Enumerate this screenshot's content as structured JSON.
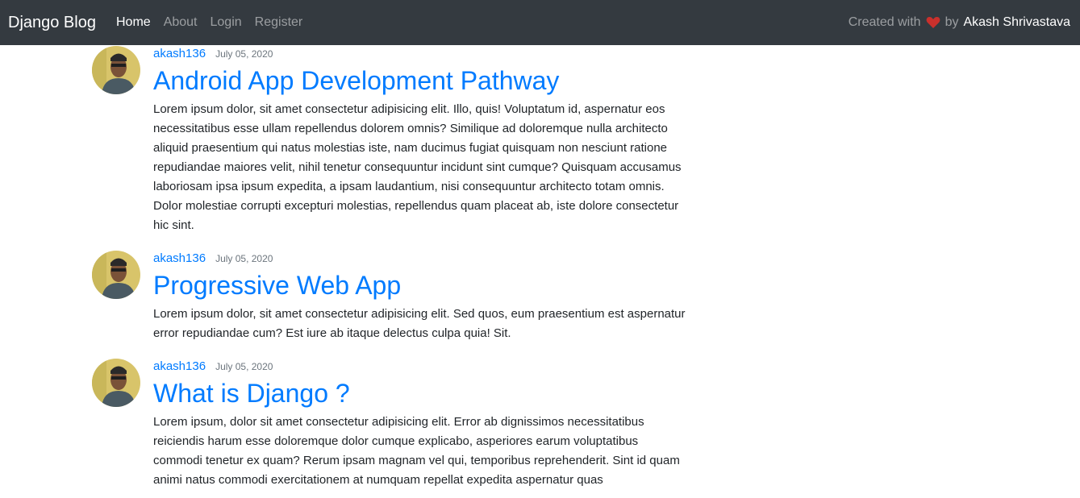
{
  "navbar": {
    "brand": "Django Blog",
    "links": [
      "Home",
      "About",
      "Login",
      "Register"
    ],
    "credit_prefix": "Created with",
    "credit_by": "by",
    "credit_author": "Akash Shrivastava",
    "heart_color": "#c9302c"
  },
  "posts": [
    {
      "author": "akash136",
      "date": "July 05, 2020",
      "title": "Android App Development Pathway",
      "content": "Lorem ipsum dolor, sit amet consectetur adipisicing elit. Illo, quis! Voluptatum id, aspernatur eos necessitatibus esse ullam repellendus dolorem omnis? Similique ad doloremque nulla architecto aliquid praesentium qui natus molestias iste, nam ducimus fugiat quisquam non nesciunt ratione repudiandae maiores velit, nihil tenetur consequuntur incidunt sint cumque? Quisquam accusamus laboriosam ipsa ipsum expedita, a ipsam laudantium, nisi consequuntur architecto totam omnis. Dolor molestiae corrupti excepturi molestias, repellendus quam placeat ab, iste dolore consectetur hic sint."
    },
    {
      "author": "akash136",
      "date": "July 05, 2020",
      "title": "Progressive Web App",
      "content": "Lorem ipsum dolor, sit amet consectetur adipisicing elit. Sed quos, eum praesentium est aspernatur error repudiandae cum? Est iure ab itaque delectus culpa quia! Sit."
    },
    {
      "author": "akash136",
      "date": "July 05, 2020",
      "title": "What is Django ?",
      "content": "Lorem ipsum, dolor sit amet consectetur adipisicing elit. Error ab dignissimos necessitatibus reiciendis harum esse doloremque dolor cumque explicabo, asperiores earum voluptatibus commodi tenetur ex quam? Rerum ipsam magnam vel qui, temporibus reprehenderit. Sint id quam animi natus commodi exercitationem at numquam repellat expedita aspernatur quas"
    }
  ],
  "colors": {
    "navbar_bg": "#343a40",
    "link_blue": "#007bff",
    "date_gray": "#6c757d",
    "text_dark": "#212529"
  }
}
